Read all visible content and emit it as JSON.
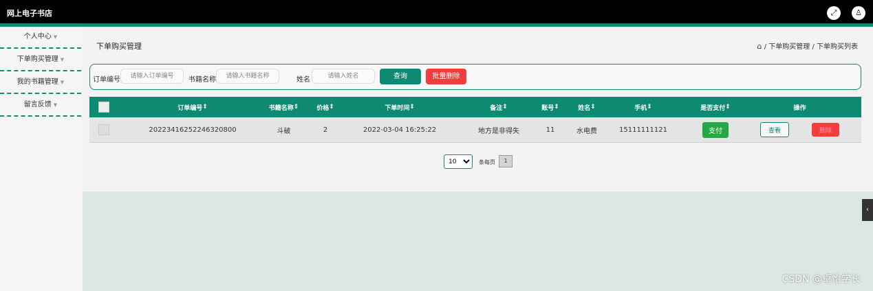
{
  "header": {
    "title": "网上电子书店"
  },
  "sidebar": {
    "items": [
      {
        "label": "个人中心"
      },
      {
        "label": "下单购买管理"
      },
      {
        "label": "我的书籍管理"
      },
      {
        "label": "留言反馈"
      }
    ]
  },
  "page": {
    "title": "下单购买管理",
    "breadcrumb": [
      "下单购买管理",
      "下单购买列表"
    ],
    "breadcrumb_sep": " / "
  },
  "search": {
    "order_label": "订单编号",
    "order_placeholder": "请输入订单编号",
    "book_label": "书籍名称",
    "book_placeholder": "请输入书籍名称",
    "name_label": "姓名",
    "name_placeholder": "请输入姓名",
    "query_button": "查询",
    "batch_delete_button": "批量删除"
  },
  "table": {
    "columns": [
      "订单编号",
      "书籍名称",
      "价格",
      "下单时间",
      "备注",
      "账号",
      "姓名",
      "手机",
      "是否支付",
      "操作"
    ],
    "sort_icon": "⇕",
    "rows": [
      {
        "order_no": "20223416252246320800",
        "book_name": "斗破",
        "price": "2",
        "order_time": "2022-03-04 16:25:22",
        "remark": "地方是非得失",
        "account": "11",
        "name": "水电费",
        "phone": "15111111121",
        "pay_button": "支付",
        "view_button": "查看",
        "delete_button": "删除"
      }
    ]
  },
  "pagination": {
    "page_size": "10",
    "per_page_label": "条每页",
    "current_page": "1"
  },
  "watermark": "CSDN @卓怡学长",
  "colors": {
    "accent": "#0e8a73",
    "danger": "#f23d3d",
    "success": "#28a745"
  }
}
